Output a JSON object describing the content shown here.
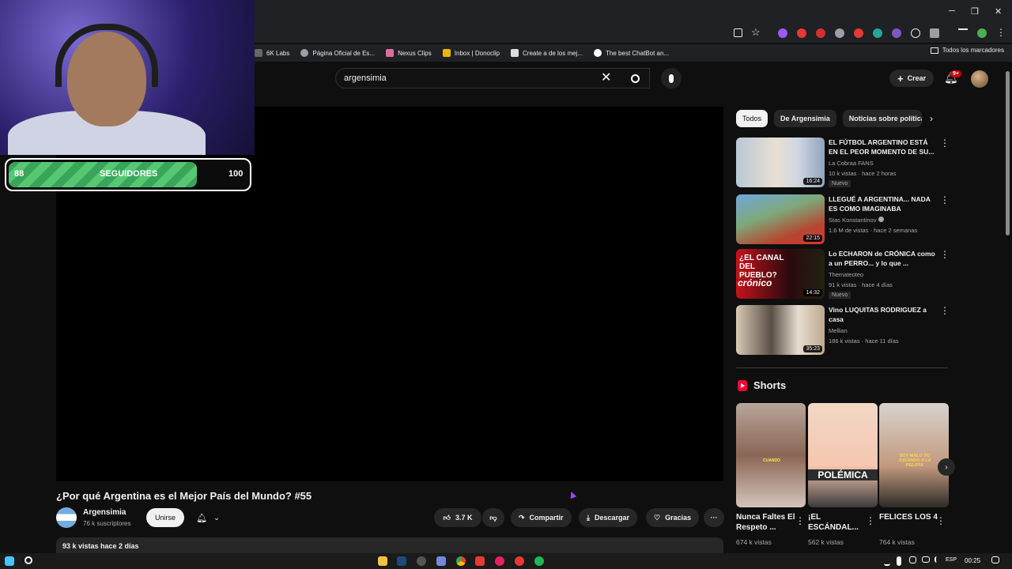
{
  "browser": {
    "bookmarks": [
      {
        "label": "6K Labs",
        "icon": "generic-icon",
        "color": "#666666"
      },
      {
        "label": "Página Oficial de Es...",
        "icon": "gear-icon",
        "color": "#9aa0a6"
      },
      {
        "label": "Nexus Clips",
        "icon": "nexus-icon",
        "color": "#e06c9f"
      },
      {
        "label": "Inbox | Donoclip",
        "icon": "donoclip-icon",
        "color": "#f0b400"
      },
      {
        "label": "Create a de los mej...",
        "icon": "doc-icon",
        "color": "#dddddd"
      },
      {
        "label": "The best ChatBot an...",
        "icon": "chatbot-icon",
        "color": "#ffffff"
      }
    ],
    "all_bookmarks": "Todos los marcadores",
    "window_controls": [
      "─",
      "❐",
      "✕"
    ]
  },
  "header": {
    "search_value": "argensimia",
    "create_label": "Crear",
    "notif_badge": "9+"
  },
  "overlay": {
    "current": "88",
    "label": "SEGUIDORES",
    "goal": "100",
    "progress": 0.88
  },
  "video": {
    "title": "¿Por qué Argentina es el Mejor País del Mundo? #55",
    "channel": "Argensimia",
    "subscribers": "76 k suscriptores",
    "join_label": "Unirse",
    "likes": "3.7 K",
    "share_label": "Compartir",
    "download_label": "Descargar",
    "thanks_label": "Gracias",
    "views_date": "93 k vistas  hace 2 días"
  },
  "chips": [
    "Todos",
    "De Argensimia",
    "Noticias sobre política"
  ],
  "recommendations": [
    {
      "title": "EL FÚTBOL ARGENTINO ESTÁ EN EL PEOR MOMENTO DE SU...",
      "channel": "La Cobraa FANS",
      "meta": "10 k vistas · hace 2 horas",
      "badge": "Nuevo",
      "duration": "16:24",
      "verified": false
    },
    {
      "title": "LLEGUÉ A ARGENTINA... NADA ES COMO IMAGINABA",
      "channel": "Stas Konstantinov",
      "meta": "1.6 M de vistas · hace 2 semanas",
      "badge": "",
      "duration": "22:15",
      "verified": true
    },
    {
      "title": "Lo ECHARON de CRÓNICA como a un PERRO... y lo que ...",
      "channel": "Themateoteo",
      "meta": "91 k vistas · hace 4 días",
      "badge": "Nuevo",
      "duration": "14:32",
      "verified": false
    },
    {
      "title": "Vino LUQUITAS RODRIGUEZ a casa",
      "channel": "Mellian",
      "meta": "186 k vistas · hace 11 días",
      "badge": "",
      "duration": "35:23",
      "verified": false
    }
  ],
  "thumb_text": {
    "cronica": "¿EL CANAL DEL PUEBLO?",
    "cronica2": "crónico"
  },
  "shorts": {
    "heading": "Shorts",
    "items": [
      {
        "title": "Nunca Faltes El Respeto ...",
        "views": "674 k vistas",
        "overlay": "CUANDO"
      },
      {
        "title": "¡EL ESCÁNDAL...",
        "views": "562 k vistas",
        "overlay": "POLÉMICA"
      },
      {
        "title": "FELICES LOS 4",
        "views": "764 k vistas",
        "overlay": "SOY MALO YO JUGANDO A LA PELOTA"
      }
    ]
  },
  "taskbar": {
    "lang": "ESP",
    "time": "00:25"
  },
  "colors": {
    "yt_bg": "#0f0f0f",
    "accent_red": "#ff0033",
    "chip_bg": "#272727",
    "progress_green": "#3aa55a"
  }
}
